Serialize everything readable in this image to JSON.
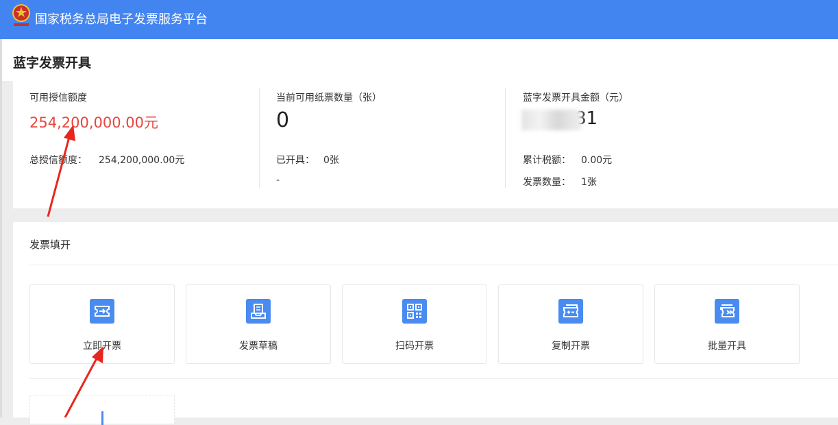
{
  "header": {
    "app_title": "国家税务总局电子发票服务平台"
  },
  "page": {
    "title": "蓝字发票开具"
  },
  "stats": {
    "credit": {
      "label": "可用授信额度",
      "value": "254,200,000.00元",
      "total_label": "总授信额度：",
      "total_value": "254,200,000.00元"
    },
    "paper": {
      "label": "当前可用纸票数量（张）",
      "value": "0",
      "issued_label": "已开具：",
      "issued_value": "0张",
      "extra": "-"
    },
    "amount": {
      "label": "蓝字发票开具金额（元）",
      "value_visible": "81",
      "tax_label": "累计税额：",
      "tax_value": "0.00元",
      "count_label": "发票数量：",
      "count_value": "1张"
    }
  },
  "fill": {
    "title": "发票填开",
    "cards": [
      {
        "label": "立即开票",
        "icon": "ticket-arrow-icon"
      },
      {
        "label": "发票草稿",
        "icon": "draft-tray-icon"
      },
      {
        "label": "扫码开票",
        "icon": "qr-code-icon"
      },
      {
        "label": "复制开票",
        "icon": "copy-ticket-icon"
      },
      {
        "label": "批量开具",
        "icon": "batch-ticket-icon"
      }
    ]
  },
  "colors": {
    "header_bg": "#4385f0",
    "accent": "#4a8bf0",
    "red": "#e8453c",
    "annotation_arrow": "#e8261d"
  }
}
